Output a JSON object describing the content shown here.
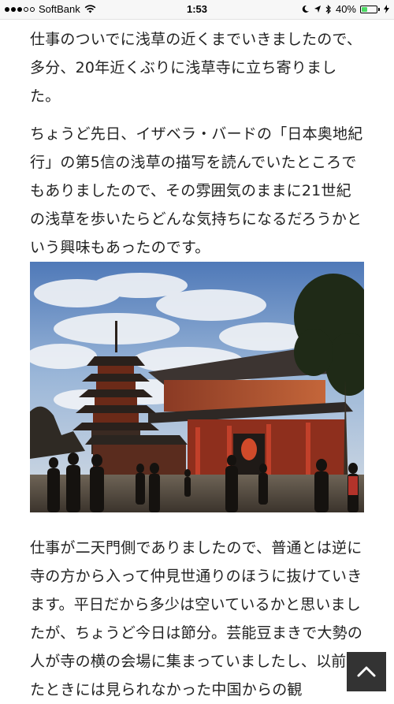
{
  "status_bar": {
    "carrier": "SoftBank",
    "time": "1:53",
    "battery_percent": "40%",
    "battery_level": 0.4,
    "signal_bars_filled": 3,
    "signal_bars_total": 5,
    "icons": [
      "wifi-icon",
      "moon-icon",
      "location-arrow-icon",
      "bluetooth-icon",
      "battery-icon",
      "charging-bolt-icon"
    ]
  },
  "article": {
    "paragraphs": [
      "仕事のついでに浅草の近くまでいきましたので、多分、20年近くぶりに浅草寺に立ち寄りました。",
      "ちょうど先日、イザベラ・バードの「日本奥地紀行」の第5信の浅草の描写を読んでいたところでもありましたので、その雰囲気のままに21世紀の浅草を歩いたらどんな気持ちになるだろうかという興味もあったのです。",
      "仕事が二天門側でありましたので、普通とは逆に寺の方から入って仲見世通りのほうに抜けていきます。平日だから多少は空いているかと思いましたが、ちょうど今日は節分。芸能豆まきで大勢の人が寺の横の会場に集まっていましたし、以前来たときには見られなかった中国からの観"
    ]
  },
  "back_to_top": {
    "icon": "chevron-up-icon",
    "background": "#333333"
  }
}
